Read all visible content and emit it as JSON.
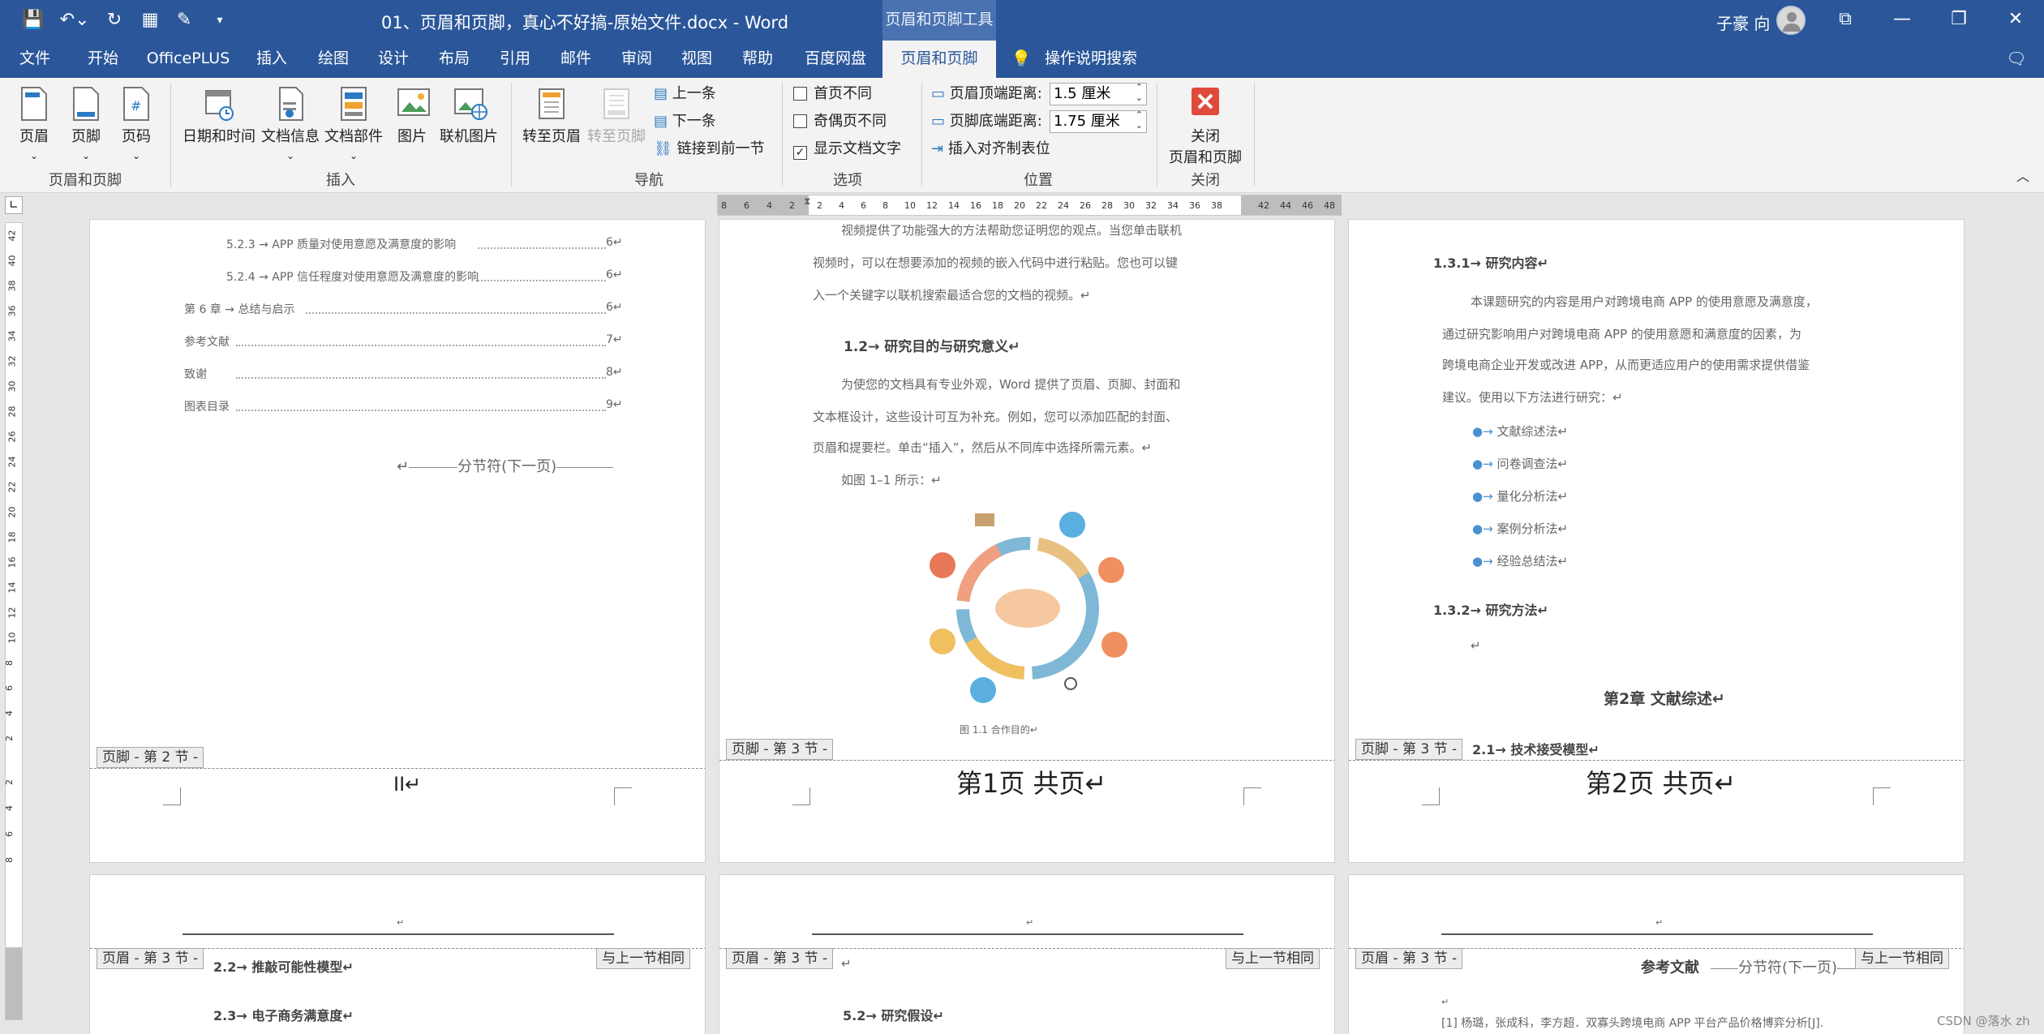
{
  "titlebar": {
    "doc_title": "01、页眉和页脚，真心不好搞-原始文件.docx  -  Word",
    "context_tool": "页眉和页脚工具",
    "user": "子豪 向"
  },
  "tabs": [
    "文件",
    "开始",
    "OfficePLUS",
    "插入",
    "绘图",
    "设计",
    "布局",
    "引用",
    "邮件",
    "审阅",
    "视图",
    "帮助",
    "百度网盘",
    "页眉和页脚",
    "操作说明搜索"
  ],
  "ribbon": {
    "groups": {
      "hf": "页眉和页脚",
      "insert": "插入",
      "nav": "导航",
      "options": "选项",
      "position": "位置",
      "close": "关闭"
    },
    "header": "页眉",
    "footer": "页脚",
    "page_number": "页码",
    "datetime": "日期和时间",
    "docinfo": "文档信息",
    "quickparts": "文档部件",
    "picture": "图片",
    "online_picture": "联机图片",
    "goto_header": "转至页眉",
    "goto_footer": "转至页脚",
    "prev": "上一条",
    "next": "下一条",
    "link_prev": "链接到前一节",
    "diff_first": "首页不同",
    "diff_odd_even": "奇偶页不同",
    "show_text": "显示文档文字",
    "header_dist_label": "页眉顶端距离:",
    "header_dist": "1.5 厘米",
    "footer_dist_label": "页脚底端距离:",
    "footer_dist": "1.75 厘米",
    "insert_align_tab": "插入对齐制表位",
    "close_line1": "关闭",
    "close_line2": "页眉和页脚"
  },
  "ruler_numbers": [
    "8",
    "6",
    "4",
    "2",
    "2",
    "4",
    "6",
    "8",
    "10",
    "12",
    "14",
    "16",
    "18",
    "20",
    "22",
    "24",
    "26",
    "28",
    "30",
    "32",
    "34",
    "36",
    "38",
    "42",
    "44",
    "46",
    "48"
  ],
  "vruler_numbers": [
    "42",
    "40",
    "38",
    "36",
    "34",
    "32",
    "30",
    "28",
    "26",
    "24",
    "22",
    "20",
    "18",
    "16",
    "14",
    "12",
    "10",
    "8",
    "6",
    "4",
    "2",
    "2",
    "4",
    "6",
    "8"
  ],
  "page1": {
    "toc": [
      {
        "text": "5.2.3 → APP 质量对使用意愿及满意度的影响",
        "num": "6↵"
      },
      {
        "text": "5.2.4 → APP 信任程度对使用意愿及满意度的影响",
        "num": "6↵"
      },
      {
        "text": "第 6 章 → 总结与启示",
        "num": "6↵"
      },
      {
        "text": "参考文献",
        "num": "7↵"
      },
      {
        "text": "致谢",
        "num": "8↵"
      },
      {
        "text": "图表目录",
        "num": "9↵"
      }
    ],
    "section_break": "分节符(下一页)",
    "footer_label": "页脚 - 第 2 节 -",
    "footer_text": "II↵"
  },
  "page2": {
    "lines": [
      "视频提供了功能强大的方法帮助您证明您的观点。当您单击联机",
      "视频时，可以在想要添加的视频的嵌入代码中进行粘贴。您也可以键",
      "入一个关键字以联机搜索最适合您的文档的视频。↵"
    ],
    "heading": "1.2→ 研究目的与研究意义↵",
    "para": [
      "为使您的文档具有专业外观，Word 提供了页眉、页脚、封面和",
      "文本框设计，这些设计可互为补充。例如，您可以添加匹配的封面、",
      "页眉和提要栏。单击“插入”，然后从不同库中选择所需元素。↵"
    ],
    "figref": "如图 1–1 所示：↵",
    "caption": "图 1.1 合作目的↵",
    "footer_label": "页脚 - 第 3 节 -",
    "footer_text": "第1页  共页↵"
  },
  "page3": {
    "heading1": "1.3.1→ 研究内容↵",
    "para": [
      "本课题研究的内容是用户对跨境电商 APP 的使用意愿及满意度，",
      "通过研究影响用户对跨境电商 APP 的使用意愿和满意度的因素，为",
      "跨境电商企业开发或改进 APP，从而更适应用户的使用需求提供借鉴",
      "建议。使用以下方法进行研究：↵"
    ],
    "bullets": [
      "文献综述法↵",
      "问卷调查法↵",
      "量化分析法↵",
      "案例分析法↵",
      "经验总结法↵"
    ],
    "heading2": "1.3.2→ 研究方法↵",
    "chapter": "第2章 文献综述↵",
    "sub": "2.1→ 技术接受模型↵",
    "footer_label": "页脚 - 第 3 节 -",
    "footer_text": "第2页  共页↵"
  },
  "page4": {
    "header_label": "页眉 - 第 3 节 -",
    "same_as_prev": "与上一节相同",
    "line1": "2.2→ 推敲可能性模型↵",
    "line2": "2.3→ 电子商务满意度↵"
  },
  "page5": {
    "header_label": "页眉 - 第 3 节 -",
    "same_as_prev": "与上一节相同",
    "line1": "5.2→ 研究假设↵"
  },
  "page6": {
    "header_label": "页眉 - 第 3 节 -",
    "same_as_prev": "与上一节相同",
    "title": "参考文献",
    "section_break": "分节符(下一页)",
    "ref": "[1] 杨璐，张成科，李方超．双寡头跨境电商 APP 平台产品价格博弈分析[J]."
  },
  "watermark": "CSDN @落水 zh",
  "colors": {
    "brand": "#2b579a",
    "close_red": "#e04a3a"
  }
}
